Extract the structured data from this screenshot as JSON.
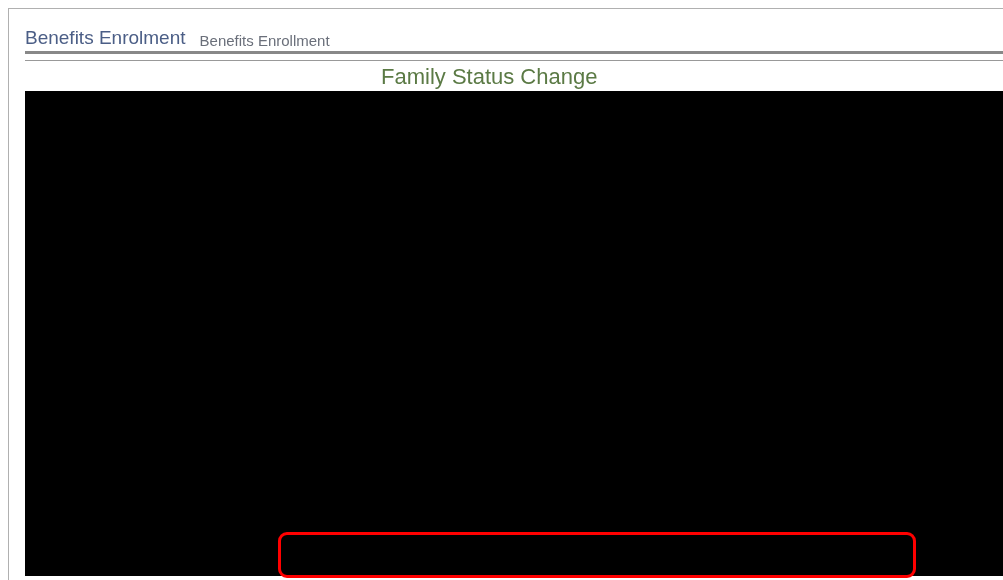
{
  "page": {
    "title": "Benefits Enrolment",
    "subtitle": "Benefits Enrollment",
    "heading": "Family Status Change"
  },
  "highlight": {
    "color": "#ff0000"
  }
}
